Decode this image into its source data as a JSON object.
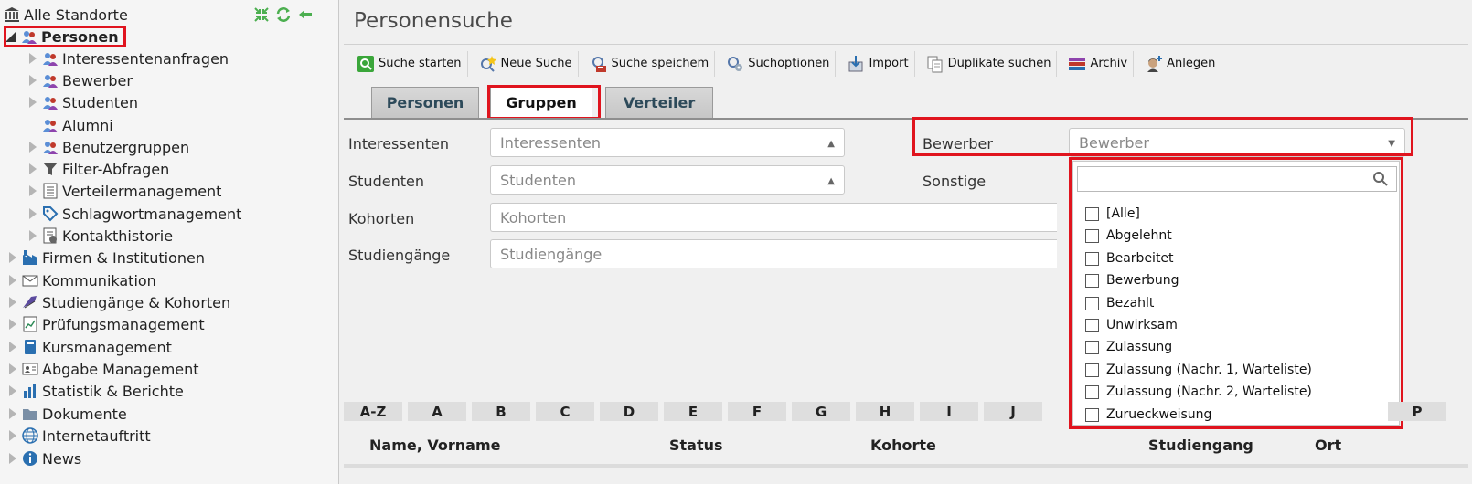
{
  "sidebar": {
    "root": {
      "label": "Alle Standorte",
      "icon": "building-icon"
    },
    "tools": [
      "collapse-icon",
      "refresh-icon",
      "back-arrow-icon"
    ],
    "items": [
      {
        "label": "Personen",
        "icon": "users-icon",
        "expanded": true,
        "level": 0
      },
      {
        "label": "Interessentenanfragen",
        "icon": "users-icon",
        "level": 1
      },
      {
        "label": "Bewerber",
        "icon": "users-icon",
        "level": 1
      },
      {
        "label": "Studenten",
        "icon": "users-icon",
        "level": 1
      },
      {
        "label": "Alumni",
        "icon": "users-icon",
        "level": 1
      },
      {
        "label": "Benutzergruppen",
        "icon": "users-icon",
        "level": 1
      },
      {
        "label": "Filter-Abfragen",
        "icon": "filter-icon",
        "level": 1
      },
      {
        "label": "Verteilermanagement",
        "icon": "list-icon",
        "level": 1
      },
      {
        "label": "Schlagwortmanagement",
        "icon": "tag-icon",
        "level": 1
      },
      {
        "label": "Kontakthistorie",
        "icon": "history-icon",
        "level": 1
      },
      {
        "label": "Firmen & Institutionen",
        "icon": "factory-icon",
        "level": 0
      },
      {
        "label": "Kommunikation",
        "icon": "envelope-icon",
        "level": 0
      },
      {
        "label": "Studiengänge & Kohorten",
        "icon": "graduation-cap-icon",
        "level": 0
      },
      {
        "label": "Prüfungsmanagement",
        "icon": "exam-icon",
        "level": 0
      },
      {
        "label": "Kursmanagement",
        "icon": "book-icon",
        "level": 0
      },
      {
        "label": "Abgabe Management",
        "icon": "id-card-icon",
        "level": 0
      },
      {
        "label": "Statistik & Berichte",
        "icon": "bar-chart-icon",
        "level": 0
      },
      {
        "label": "Dokumente",
        "icon": "folder-icon",
        "level": 0
      },
      {
        "label": "Internetauftritt",
        "icon": "globe-icon",
        "level": 0
      },
      {
        "label": "News",
        "icon": "info-icon",
        "level": 0
      }
    ]
  },
  "main": {
    "title": "Personensuche",
    "toolbar": [
      {
        "label": "Suche starten",
        "icon": "search-start-icon"
      },
      {
        "label": "Neue Suche",
        "icon": "new-search-icon"
      },
      {
        "label": "Suche speichem",
        "icon": "save-search-icon"
      },
      {
        "label": "Suchoptionen",
        "icon": "search-options-icon"
      },
      {
        "label": "Import",
        "icon": "import-icon"
      },
      {
        "label": "Duplikate suchen",
        "icon": "duplicates-icon"
      },
      {
        "label": "Archiv",
        "icon": "archive-icon"
      },
      {
        "label": "Anlegen",
        "icon": "add-person-icon"
      }
    ],
    "tabs": [
      "Personen",
      "Gruppen",
      "Verteiler"
    ],
    "active_tab": "Gruppen",
    "fields": [
      {
        "label": "Interessenten",
        "placeholder": "Interessenten"
      },
      {
        "label": "Studenten",
        "placeholder": "Studenten"
      },
      {
        "label": "Kohorten",
        "placeholder": "Kohorten"
      },
      {
        "label": "Studiengänge",
        "placeholder": "Studiengänge"
      },
      {
        "label": "Bewerber",
        "placeholder": "Bewerber"
      },
      {
        "label": "Sonstige",
        "placeholder": ""
      }
    ],
    "dropdown": {
      "search_value": "",
      "options": [
        "[Alle]",
        "Abgelehnt",
        "Bearbeitet",
        "Bewerbung",
        "Bezahlt",
        "Unwirksam",
        "Zulassung",
        "Zulassung (Nachr. 1, Warteliste)",
        "Zulassung (Nachr. 2, Warteliste)",
        "Zurueckweisung"
      ]
    },
    "alphabet": [
      "A-Z",
      "A",
      "B",
      "C",
      "D",
      "E",
      "F",
      "G",
      "H",
      "I",
      "J",
      "P"
    ],
    "columns": [
      "Name, Vorname",
      "Status",
      "Kohorte",
      "Studiengang",
      "Ort"
    ]
  },
  "colors": {
    "highlight": "#e0141e",
    "tab_text": "#2d4a5a"
  }
}
